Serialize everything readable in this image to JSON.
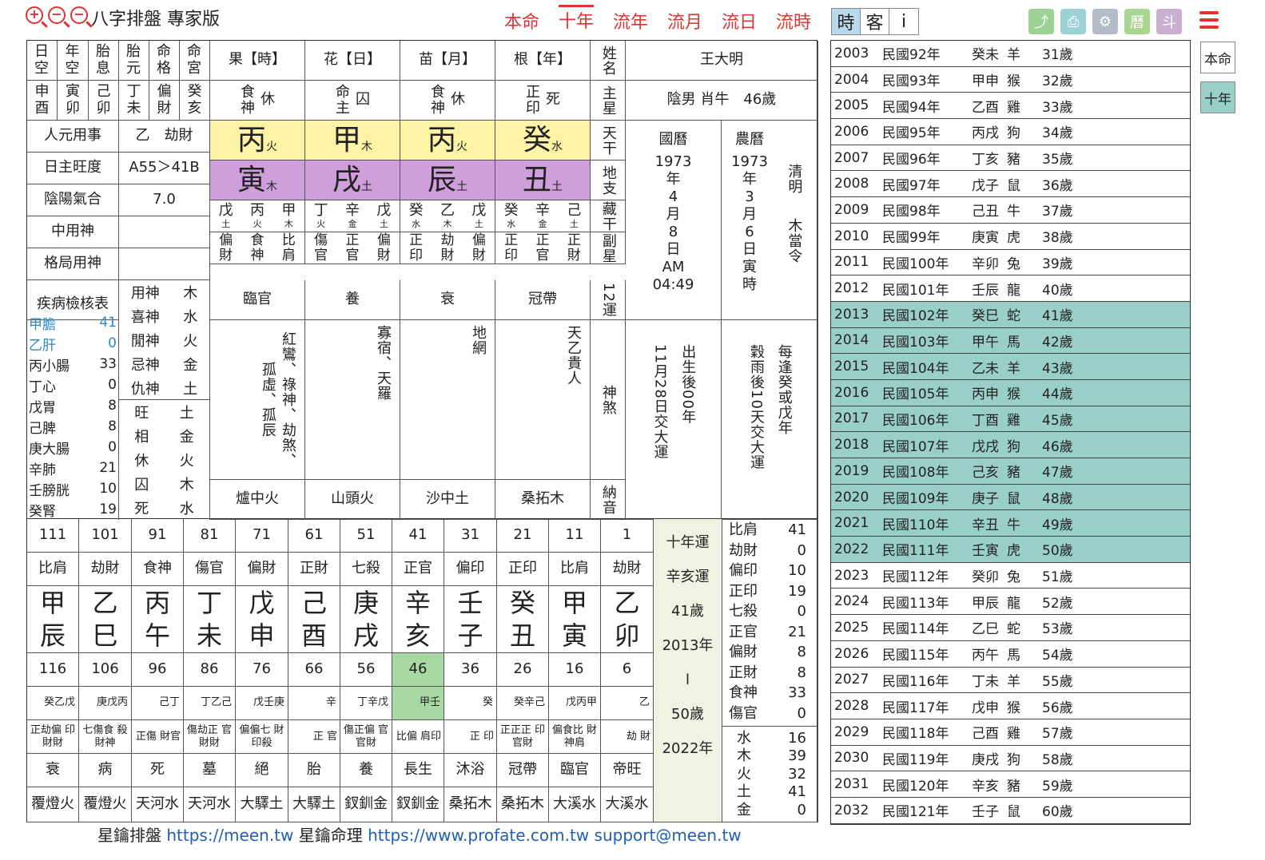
{
  "app": {
    "title": "八字排盤 專家版",
    "zoom_in": "+",
    "zoom_out": "−",
    "zoom_reset": "−"
  },
  "nav": {
    "tabs": [
      "本命",
      "十年",
      "流年",
      "流月",
      "流日",
      "流時"
    ],
    "active": "十年"
  },
  "toggles": [
    "時",
    "客",
    "i"
  ],
  "toolbar_icons": [
    "share-icon",
    "print-icon",
    "settings-icon",
    "calendar-icon",
    "chart-icon"
  ],
  "toolbar_icon_labels": [
    "",
    "",
    "",
    "曆",
    "斗"
  ],
  "side": {
    "btn1": "本命",
    "btn2": "十年"
  },
  "chart": {
    "head_labels": [
      "日空",
      "年空",
      "胎息",
      "胎元",
      "命格",
      "命宮"
    ],
    "head_values": [
      "申酉",
      "寅卯",
      "己卯",
      "丁未",
      "偏財",
      "癸亥"
    ],
    "pillar_titles": [
      "果【時】",
      "花【日】",
      "苗【月】",
      "根【年】"
    ],
    "name_label": "姓名",
    "name": "王大明",
    "main_star_label": "主星",
    "main_stars": [
      {
        "a": "食神",
        "b": "休"
      },
      {
        "a": "命主",
        "b": "囚"
      },
      {
        "a": "食神",
        "b": "休"
      },
      {
        "a": "正印",
        "b": "死"
      }
    ],
    "gender_info": "陰男 肖牛　46歲",
    "left_rows": [
      {
        "k": "人元用事",
        "v": "乙　劫財"
      },
      {
        "k": "日主旺度",
        "v": "A55＞41B"
      },
      {
        "k": "陰陽氣合",
        "v": "7.0"
      },
      {
        "k": "中用神",
        "v": ""
      },
      {
        "k": "格局用神",
        "v": ""
      }
    ],
    "stems": [
      {
        "c": "丙",
        "e": "火"
      },
      {
        "c": "甲",
        "e": "木"
      },
      {
        "c": "丙",
        "e": "火"
      },
      {
        "c": "癸",
        "e": "水"
      }
    ],
    "branches": [
      {
        "c": "寅",
        "e": "木"
      },
      {
        "c": "戌",
        "e": "土"
      },
      {
        "c": "辰",
        "e": "土"
      },
      {
        "c": "丑",
        "e": "土"
      }
    ],
    "stem_label": "天干",
    "branch_label": "地支",
    "hidden_label": "藏干",
    "sub_label": "副星",
    "luck12_label": "12運",
    "shensha_label": "神煞",
    "nayin_label": "納音",
    "hidden": [
      [
        {
          "c": "戊",
          "e": "土"
        },
        {
          "c": "丙",
          "e": "火"
        },
        {
          "c": "甲",
          "e": "木"
        }
      ],
      [
        {
          "c": "丁",
          "e": "火"
        },
        {
          "c": "辛",
          "e": "金"
        },
        {
          "c": "戊",
          "e": "土"
        }
      ],
      [
        {
          "c": "癸",
          "e": "水"
        },
        {
          "c": "乙",
          "e": "木"
        },
        {
          "c": "戊",
          "e": "土"
        }
      ],
      [
        {
          "c": "癸",
          "e": "水"
        },
        {
          "c": "辛",
          "e": "金"
        },
        {
          "c": "己",
          "e": "土"
        }
      ]
    ],
    "substars": [
      [
        "偏財",
        "食神",
        "比肩"
      ],
      [
        "傷官",
        "正官",
        "偏財"
      ],
      [
        "正印",
        "劫財",
        "偏財"
      ],
      [
        "正印",
        "正官",
        "正財"
      ]
    ],
    "luck12": [
      "臨官",
      "養",
      "衰",
      "冠帶"
    ],
    "shensha": [
      "紅鸞、祿神、劫煞、孤虛、孤辰",
      "寡宿、天羅",
      "地網",
      "天乙貴人"
    ],
    "nayin": [
      "爐中火",
      "山頭火",
      "沙中土",
      "桑拓木"
    ],
    "calendar": {
      "solar_label": "國曆",
      "lunar_label": "農曆",
      "solar": [
        "1973",
        "年",
        "4",
        "月",
        "8",
        "日",
        "AM",
        "04:49"
      ],
      "lunar": [
        "1973",
        "年",
        "3",
        "月",
        "6",
        "日",
        "寅",
        "時"
      ],
      "term": "清明",
      "ruler": "木當令"
    },
    "dayun_start": [
      "出生後00年",
      "11月28日交大運"
    ],
    "dayun_rule": [
      "每逢癸或戊年",
      "穀雨後10天交大運"
    ],
    "health_title": "疾病檢核表",
    "health": [
      {
        "k": "甲膽",
        "v": "41",
        "blue": true
      },
      {
        "k": "乙肝",
        "v": "0",
        "blue": true
      },
      {
        "k": "丙小腸",
        "v": "33"
      },
      {
        "k": "丁心",
        "v": "0"
      },
      {
        "k": "戊胃",
        "v": "8"
      },
      {
        "k": "己脾",
        "v": "8"
      },
      {
        "k": "庚大腸",
        "v": "0"
      },
      {
        "k": "辛肺",
        "v": "21"
      },
      {
        "k": "壬膀胱",
        "v": "10"
      },
      {
        "k": "癸腎",
        "v": "19"
      }
    ],
    "gods": [
      {
        "k": "用神",
        "v": "木"
      },
      {
        "k": "喜神",
        "v": "水"
      },
      {
        "k": "閒神",
        "v": "火"
      },
      {
        "k": "忌神",
        "v": "金"
      },
      {
        "k": "仇神",
        "v": "土"
      }
    ],
    "states": [
      {
        "k": "旺",
        "v": "土"
      },
      {
        "k": "相",
        "v": "金"
      },
      {
        "k": "休",
        "v": "火"
      },
      {
        "k": "囚",
        "v": "木"
      },
      {
        "k": "死",
        "v": "水"
      }
    ]
  },
  "decade": {
    "ages": [
      "111",
      "101",
      "91",
      "81",
      "71",
      "61",
      "51",
      "41",
      "31",
      "21",
      "11",
      "1"
    ],
    "gods": [
      "比肩",
      "劫財",
      "食神",
      "傷官",
      "偏財",
      "正財",
      "七殺",
      "正官",
      "偏印",
      "正印",
      "比肩",
      "劫財"
    ],
    "stems": [
      "甲",
      "乙",
      "丙",
      "丁",
      "戊",
      "己",
      "庚",
      "辛",
      "壬",
      "癸",
      "甲",
      "乙"
    ],
    "branches": [
      "辰",
      "巳",
      "午",
      "未",
      "申",
      "酉",
      "戌",
      "亥",
      "子",
      "丑",
      "寅",
      "卯"
    ],
    "ages2": [
      "116",
      "106",
      "96",
      "86",
      "76",
      "66",
      "56",
      "46",
      "36",
      "26",
      "16",
      "6"
    ],
    "hidden": [
      "癸乙戊",
      "庚戊丙",
      "己丁",
      "丁乙己",
      "戊壬庚",
      "辛",
      "丁辛戊",
      "甲壬",
      "癸",
      "癸辛己",
      "戊丙甲",
      "乙"
    ],
    "hidden_gods": [
      "正劫偏 印財財",
      "七傷食 殺財神",
      "正傷 財官",
      "傷劫正 官財財",
      "偏偏七 財印殺",
      "正 官",
      "傷正偏 官官財",
      "比偏 肩印",
      "正 印",
      "正正正 印官財",
      "偏食比 財神肩",
      "劫 財"
    ],
    "luck12": [
      "衰",
      "病",
      "死",
      "墓",
      "絕",
      "胎",
      "養",
      "長生",
      "沐浴",
      "冠帶",
      "臨官",
      "帝旺"
    ],
    "nayin": [
      "覆燈火",
      "覆燈火",
      "天河水",
      "天河水",
      "大驛土",
      "大驛土",
      "釵釧金",
      "釵釧金",
      "桑拓木",
      "桑拓木",
      "大溪水",
      "大溪水"
    ],
    "info": [
      "十年運",
      "辛亥運",
      "41歲",
      "2013年",
      "l",
      "50歲",
      "2022年"
    ],
    "stats": [
      {
        "k": "比肩",
        "v": "41"
      },
      {
        "k": "劫財",
        "v": "0"
      },
      {
        "k": "偏印",
        "v": "10"
      },
      {
        "k": "正印",
        "v": "19"
      },
      {
        "k": "七殺",
        "v": "0"
      },
      {
        "k": "正官",
        "v": "21"
      },
      {
        "k": "偏財",
        "v": "8"
      },
      {
        "k": "正財",
        "v": "8"
      },
      {
        "k": "食神",
        "v": "33"
      },
      {
        "k": "傷官",
        "v": "0"
      }
    ],
    "elements": [
      {
        "k": "水",
        "v": "16"
      },
      {
        "k": "木",
        "v": "39"
      },
      {
        "k": "火",
        "v": "32"
      },
      {
        "k": "土",
        "v": "41"
      },
      {
        "k": "金",
        "v": "0"
      }
    ]
  },
  "years": [
    {
      "y": "2003",
      "m": "民國92年",
      "gz": "癸未",
      "a": "羊",
      "age": "31歲",
      "hl": false
    },
    {
      "y": "2004",
      "m": "民國93年",
      "gz": "甲申",
      "a": "猴",
      "age": "32歲",
      "hl": false
    },
    {
      "y": "2005",
      "m": "民國94年",
      "gz": "乙酉",
      "a": "雞",
      "age": "33歲",
      "hl": false
    },
    {
      "y": "2006",
      "m": "民國95年",
      "gz": "丙戌",
      "a": "狗",
      "age": "34歲",
      "hl": false
    },
    {
      "y": "2007",
      "m": "民國96年",
      "gz": "丁亥",
      "a": "豬",
      "age": "35歲",
      "hl": false
    },
    {
      "y": "2008",
      "m": "民國97年",
      "gz": "戊子",
      "a": "鼠",
      "age": "36歲",
      "hl": false
    },
    {
      "y": "2009",
      "m": "民國98年",
      "gz": "己丑",
      "a": "牛",
      "age": "37歲",
      "hl": false
    },
    {
      "y": "2010",
      "m": "民國99年",
      "gz": "庚寅",
      "a": "虎",
      "age": "38歲",
      "hl": false
    },
    {
      "y": "2011",
      "m": "民國100年",
      "gz": "辛卯",
      "a": "兔",
      "age": "39歲",
      "hl": false
    },
    {
      "y": "2012",
      "m": "民國101年",
      "gz": "壬辰",
      "a": "龍",
      "age": "40歲",
      "hl": false
    },
    {
      "y": "2013",
      "m": "民國102年",
      "gz": "癸巳",
      "a": "蛇",
      "age": "41歲",
      "hl": true
    },
    {
      "y": "2014",
      "m": "民國103年",
      "gz": "甲午",
      "a": "馬",
      "age": "42歲",
      "hl": true
    },
    {
      "y": "2015",
      "m": "民國104年",
      "gz": "乙未",
      "a": "羊",
      "age": "43歲",
      "hl": true
    },
    {
      "y": "2016",
      "m": "民國105年",
      "gz": "丙申",
      "a": "猴",
      "age": "44歲",
      "hl": true
    },
    {
      "y": "2017",
      "m": "民國106年",
      "gz": "丁酉",
      "a": "雞",
      "age": "45歲",
      "hl": true
    },
    {
      "y": "2018",
      "m": "民國107年",
      "gz": "戊戌",
      "a": "狗",
      "age": "46歲",
      "hl": true
    },
    {
      "y": "2019",
      "m": "民國108年",
      "gz": "己亥",
      "a": "豬",
      "age": "47歲",
      "hl": true
    },
    {
      "y": "2020",
      "m": "民國109年",
      "gz": "庚子",
      "a": "鼠",
      "age": "48歲",
      "hl": true
    },
    {
      "y": "2021",
      "m": "民國110年",
      "gz": "辛丑",
      "a": "牛",
      "age": "49歲",
      "hl": true
    },
    {
      "y": "2022",
      "m": "民國111年",
      "gz": "壬寅",
      "a": "虎",
      "age": "50歲",
      "hl": true
    },
    {
      "y": "2023",
      "m": "民國112年",
      "gz": "癸卯",
      "a": "兔",
      "age": "51歲",
      "hl": false
    },
    {
      "y": "2024",
      "m": "民國113年",
      "gz": "甲辰",
      "a": "龍",
      "age": "52歲",
      "hl": false
    },
    {
      "y": "2025",
      "m": "民國114年",
      "gz": "乙巳",
      "a": "蛇",
      "age": "53歲",
      "hl": false
    },
    {
      "y": "2026",
      "m": "民國115年",
      "gz": "丙午",
      "a": "馬",
      "age": "54歲",
      "hl": false
    },
    {
      "y": "2027",
      "m": "民國116年",
      "gz": "丁未",
      "a": "羊",
      "age": "55歲",
      "hl": false
    },
    {
      "y": "2028",
      "m": "民國117年",
      "gz": "戊申",
      "a": "猴",
      "age": "56歲",
      "hl": false
    },
    {
      "y": "2029",
      "m": "民國118年",
      "gz": "己酉",
      "a": "雞",
      "age": "57歲",
      "hl": false
    },
    {
      "y": "2030",
      "m": "民國119年",
      "gz": "庚戌",
      "a": "狗",
      "age": "58歲",
      "hl": false
    },
    {
      "y": "2031",
      "m": "民國120年",
      "gz": "辛亥",
      "a": "豬",
      "age": "59歲",
      "hl": false
    },
    {
      "y": "2032",
      "m": "民國121年",
      "gz": "壬子",
      "a": "鼠",
      "age": "60歲",
      "hl": false
    }
  ],
  "footer": {
    "brand1": "星鑰排盤",
    "url1": "https://meen.tw",
    "brand2": "星鑰命理",
    "url2": "https://www.profate.com.tw",
    "email": "support@meen.tw"
  },
  "colors": {
    "accent": "#e03434",
    "yellow": "#fdf3a6",
    "purple": "#cf9fdc",
    "highlight": "#99cfc8",
    "green": "#a9d9a2",
    "link": "#1f5fb5",
    "blue_text": "#2e88c7"
  }
}
